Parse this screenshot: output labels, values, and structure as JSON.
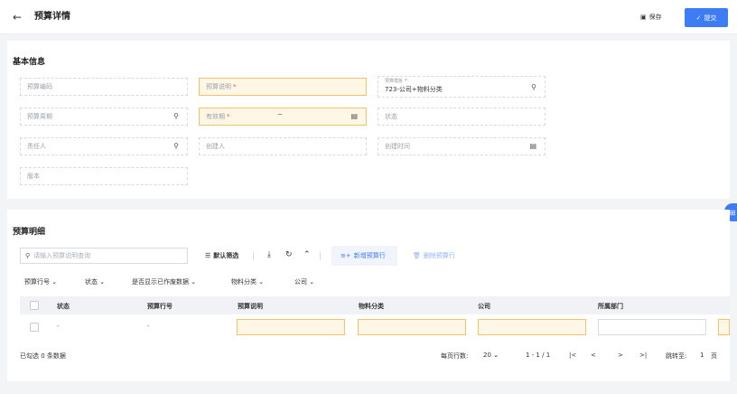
{
  "header": {
    "back_icon": "arrow-left-icon",
    "title": "预算详情",
    "save_label": "保存",
    "submit_label": "提交"
  },
  "basic": {
    "section_title": "基本信息",
    "fields": {
      "budget_code": "预算编码",
      "budget_desc": "预算说明",
      "template_label": "预算模板",
      "template_value": "723-公司+物料分类",
      "budget_period": "预算周期",
      "valid_period": "有效期",
      "valid_sep": "~",
      "status": "状态",
      "owner": "责任人",
      "creator": "创建人",
      "create_time": "创建时间",
      "version": "版本"
    },
    "required_mark": "*"
  },
  "detail": {
    "section_title": "预算明细",
    "search_placeholder": "请输入预算说明查询",
    "toolbar": {
      "default_filter": "默认筛选",
      "add_row": "新增预算行",
      "delete_row": "删除预算行"
    },
    "filters": [
      "预算行号",
      "状态",
      "是否显示已作废数据",
      "物料分类",
      "公司"
    ],
    "columns": [
      "状态",
      "预算行号",
      "预算说明",
      "物料分类",
      "公司",
      "所属部门"
    ],
    "row": {
      "status": "-",
      "line_no": "-"
    }
  },
  "footer": {
    "selected_text": "已勾选 0 条数据",
    "per_page_label": "每页行数:",
    "per_page_value": "20",
    "range": "1 - 1 / 1",
    "first": "|<",
    "prev": "<",
    "next": ">",
    "last": ">|",
    "jump_label": "跳转至:",
    "jump_value": "1",
    "page_unit": "页"
  },
  "colors": {
    "primary": "#3d7cf5",
    "required_bg": "#fff7e6",
    "required_border": "#f5c26b"
  }
}
